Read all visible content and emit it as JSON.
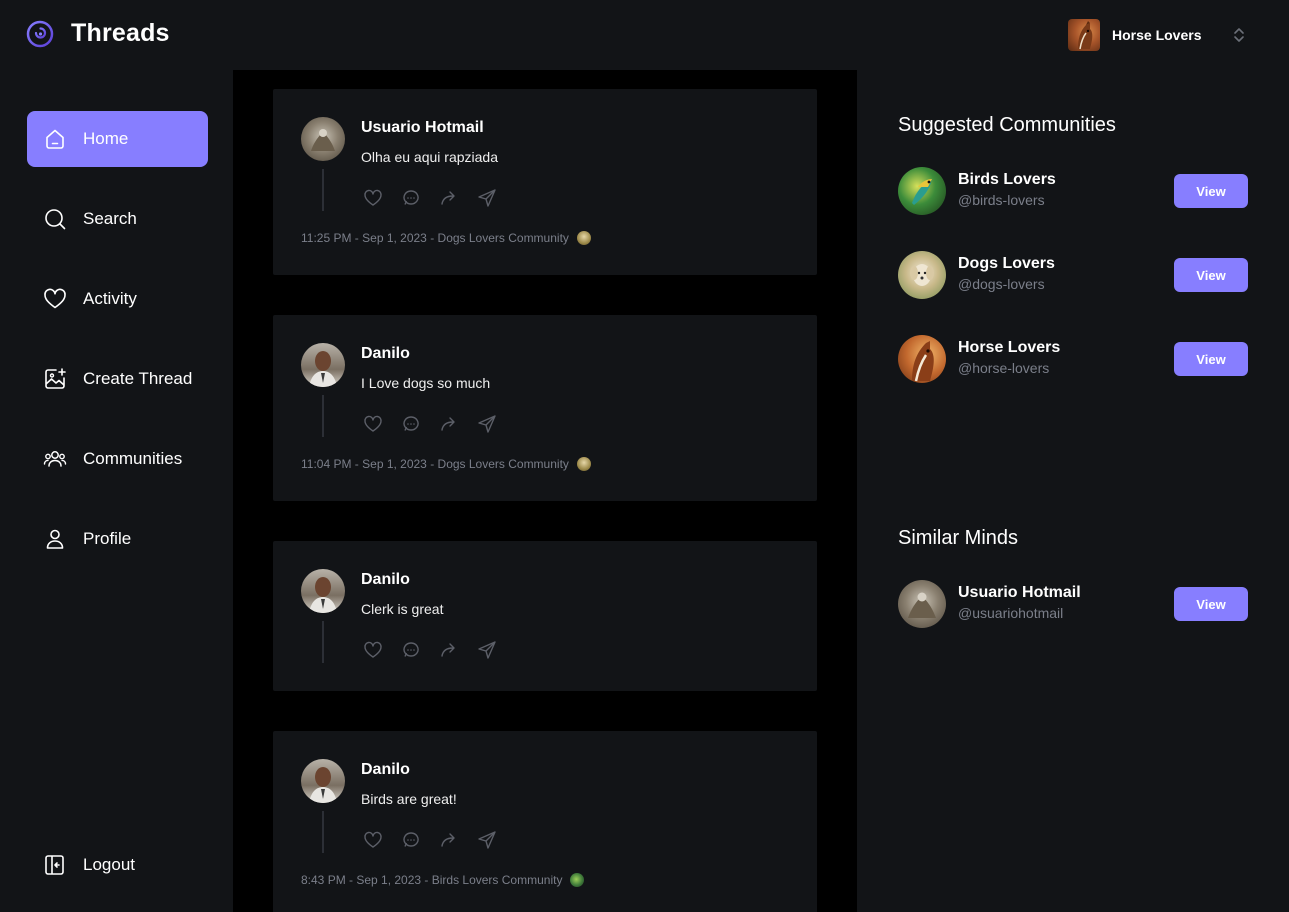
{
  "brand": {
    "name": "Threads"
  },
  "org_switcher": {
    "name": "Horse Lovers"
  },
  "sidebar": {
    "items": [
      {
        "label": "Home",
        "icon": "home-icon",
        "active": true
      },
      {
        "label": "Search",
        "icon": "search-icon",
        "active": false
      },
      {
        "label": "Activity",
        "icon": "heart-icon",
        "active": false
      },
      {
        "label": "Create Thread",
        "icon": "create-image-icon",
        "active": false
      },
      {
        "label": "Communities",
        "icon": "communities-icon",
        "active": false
      },
      {
        "label": "Profile",
        "icon": "profile-icon",
        "active": false
      }
    ],
    "logout_label": "Logout"
  },
  "feed": {
    "threads": [
      {
        "author": "Usuario Hotmail",
        "text": "Olha eu aqui rapziada",
        "meta": "11:25 PM - Sep 1, 2023 - Dogs Lovers Community"
      },
      {
        "author": "Danilo",
        "text": "I Love dogs so much",
        "meta": "11:04 PM - Sep 1, 2023 - Dogs Lovers Community"
      },
      {
        "author": "Danilo",
        "text": "Clerk is great",
        "meta": ""
      },
      {
        "author": "Danilo",
        "text": "Birds are great!",
        "meta": "8:43 PM - Sep 1, 2023 - Birds Lovers Community"
      }
    ]
  },
  "rightbar": {
    "suggested_title": "Suggested Communities",
    "communities": [
      {
        "name": "Birds Lovers",
        "handle": "@birds-lovers",
        "button": "View"
      },
      {
        "name": "Dogs Lovers",
        "handle": "@dogs-lovers",
        "button": "View"
      },
      {
        "name": "Horse Lovers",
        "handle": "@horse-lovers",
        "button": "View"
      }
    ],
    "similar_title": "Similar Minds",
    "users": [
      {
        "name": "Usuario Hotmail",
        "handle": "@usuariohotmail",
        "button": "View"
      }
    ]
  },
  "colors": {
    "accent": "#877eff",
    "panel": "#121417",
    "feed_background": "#000000",
    "muted_text": "#7b7f8a"
  }
}
